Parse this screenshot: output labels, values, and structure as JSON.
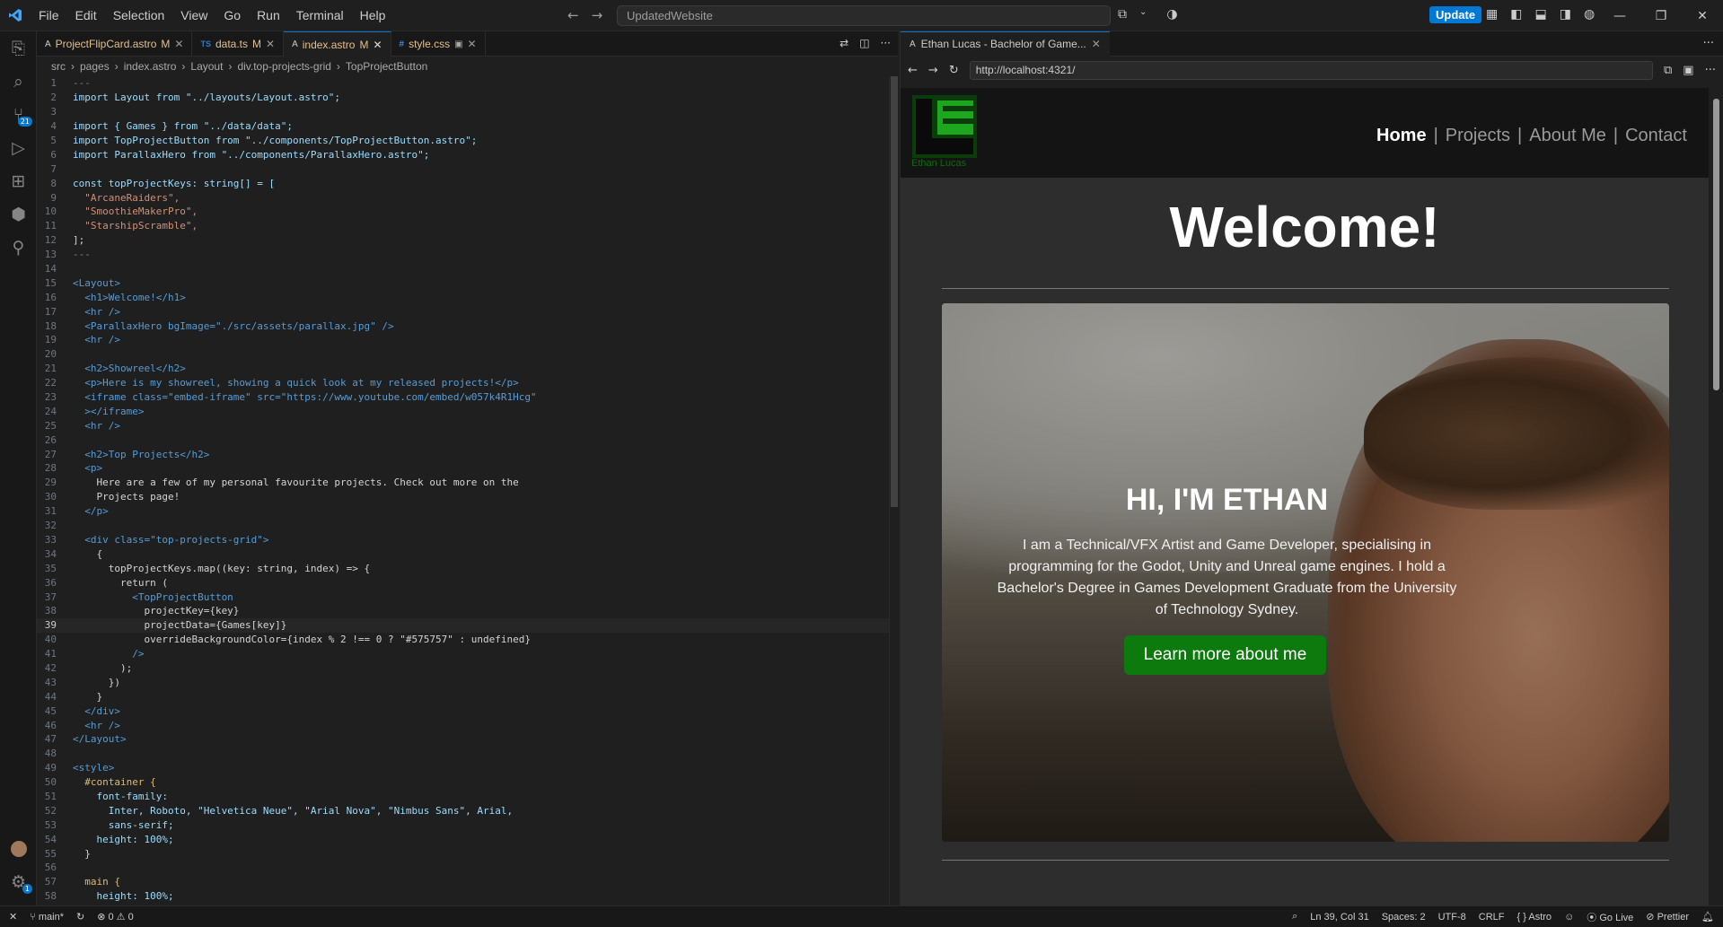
{
  "app": {
    "title_search": "UpdatedWebsite",
    "update_label": "Update",
    "menu": [
      "File",
      "Edit",
      "Selection",
      "View",
      "Go",
      "Run",
      "Terminal",
      "Help"
    ]
  },
  "editor_tabs": [
    {
      "label": "ProjectFlipCard.astro",
      "status": "M",
      "icon": "astro-icon"
    },
    {
      "label": "data.ts",
      "status": "M",
      "icon": "ts-icon"
    },
    {
      "label": "index.astro",
      "status": "M",
      "icon": "astro-icon",
      "active": true
    },
    {
      "label": "style.css",
      "status": "",
      "icon": "css-icon"
    }
  ],
  "breadcrumb": [
    "src",
    "pages",
    "index.astro",
    "Layout",
    "div.top-projects-grid",
    "TopProjectButton"
  ],
  "code_lines": [
    "---",
    "import Layout from \"../layouts/Layout.astro\";",
    "",
    "import { Games } from \"../data/data\";",
    "import TopProjectButton from \"../components/TopProjectButton.astro\";",
    "import ParallaxHero from \"../components/ParallaxHero.astro\";",
    "",
    "const topProjectKeys: string[] = [",
    "  \"ArcaneRaiders\",",
    "  \"SmoothieMakerPro\",",
    "  \"StarshipScramble\",",
    "];",
    "---",
    "",
    "<Layout>",
    "  <h1>Welcome!</h1>",
    "  <hr />",
    "  <ParallaxHero bgImage=\"./src/assets/parallax.jpg\" />",
    "  <hr />",
    "",
    "  <h2>Showreel</h2>",
    "  <p>Here is my showreel, showing a quick look at my released projects!</p>",
    "  <iframe class=\"embed-iframe\" src=\"https://www.youtube.com/embed/w057k4R1Hcg\"",
    "  ></iframe>",
    "  <hr />",
    "",
    "  <h2>Top Projects</h2>",
    "  <p>",
    "    Here are a few of my personal favourite projects. Check out more on the",
    "    Projects page!",
    "  </p>",
    "",
    "  <div class=\"top-projects-grid\">",
    "    {",
    "      topProjectKeys.map((key: string, index) => {",
    "        return (",
    "          <TopProjectButton",
    "            projectKey={key}",
    "            projectData={Games[key]}",
    "            overrideBackgroundColor={index % 2 !== 0 ? \"#575757\" : undefined}",
    "          />",
    "        );",
    "      })",
    "    }",
    "  </div>",
    "  <hr />",
    "</Layout>",
    "",
    "<style>",
    "  #container {",
    "    font-family:",
    "      Inter, Roboto, \"Helvetica Neue\", \"Arial Nova\", \"Nimbus Sans\", Arial,",
    "      sans-serif;",
    "    height: 100%;",
    "  }",
    "",
    "  main {",
    "    height: 100%;"
  ],
  "current_line": 39,
  "preview": {
    "tab_title": "Ethan Lucas - Bachelor of Game...",
    "url": "http://localhost:4321/",
    "site": {
      "logo_text": "Ethan Lucas",
      "nav": [
        "Home",
        "Projects",
        "About Me",
        "Contact"
      ],
      "heading": "Welcome!",
      "hero_title": "HI, I'M ETHAN",
      "hero_text": "I am a Technical/VFX Artist and Game Developer, specialising in programming for the Godot, Unity and Unreal game engines. I hold a Bachelor's Degree in Games Development Graduate from the University of Technology Sydney.",
      "hero_button": "Learn more about me"
    }
  },
  "status": {
    "branch": "main*",
    "errors": "0",
    "warnings": "0",
    "cursor": "Ln 39, Col 31",
    "spaces": "Spaces: 2",
    "encoding": "UTF-8",
    "eol": "CRLF",
    "language": "Astro",
    "golive": "Go Live",
    "prettier": "Prettier"
  },
  "colors": {
    "accent": "#0078d4",
    "site_green": "#0d7a0d"
  }
}
